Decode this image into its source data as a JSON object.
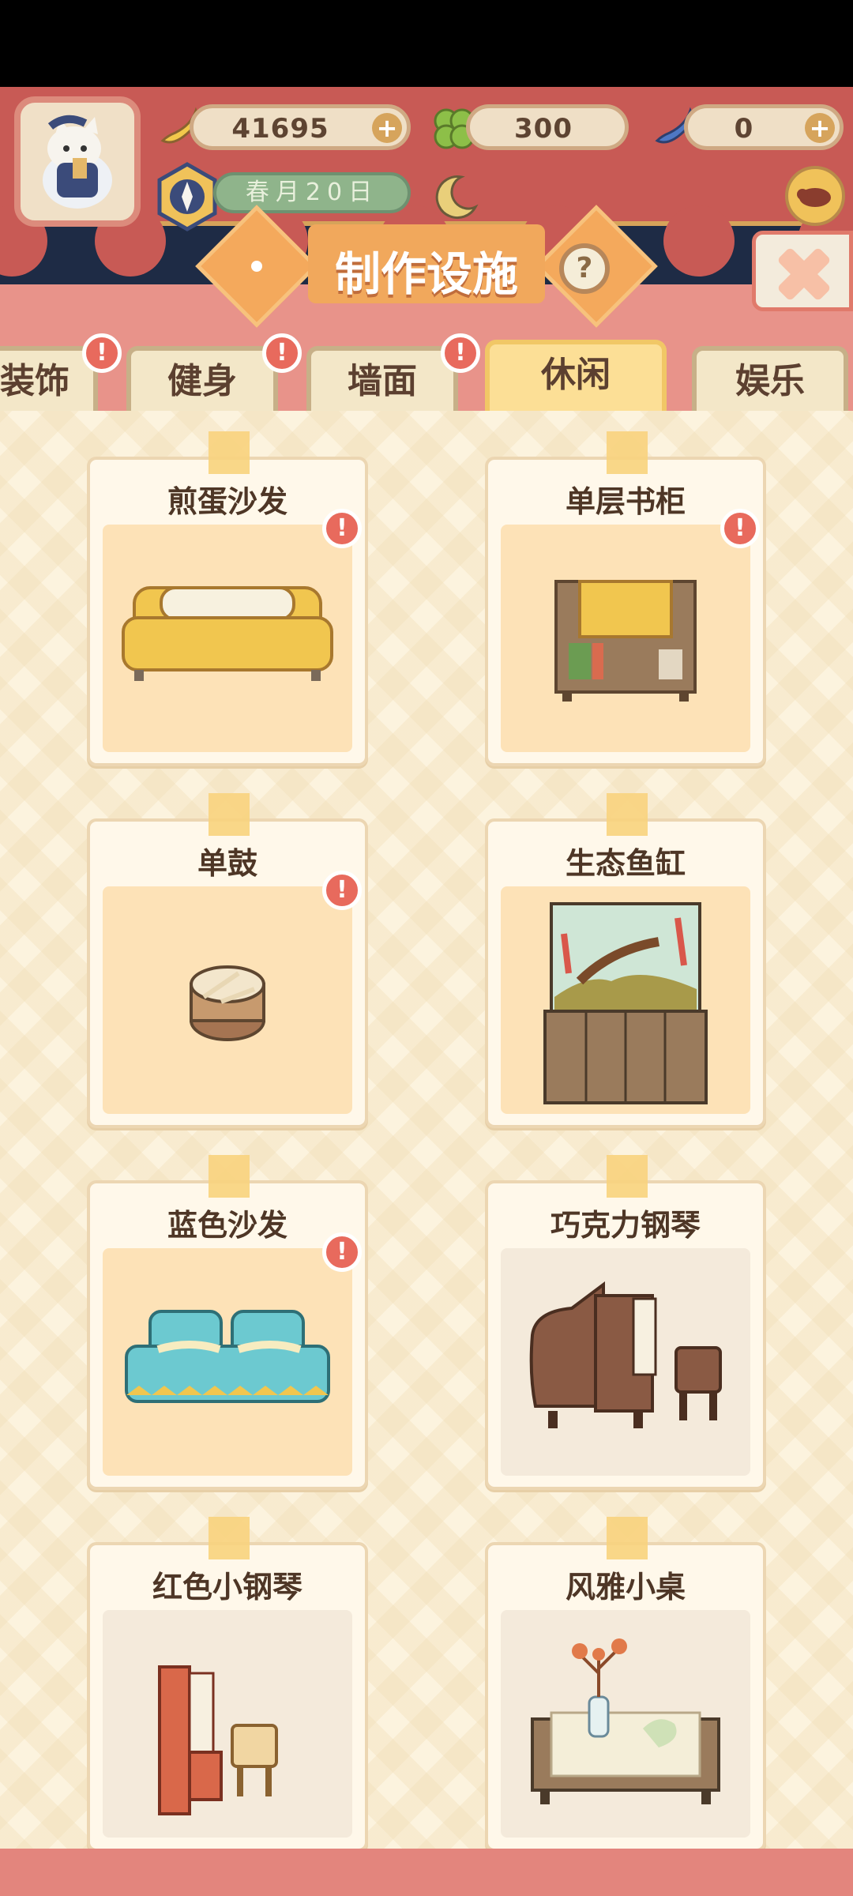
{
  "header": {
    "currency": [
      {
        "icon": "banana-icon",
        "value": "41695",
        "plus": "+"
      },
      {
        "icon": "clover-icon",
        "value": "300",
        "plus": ""
      },
      {
        "icon": "blue-banana-icon",
        "value": "0",
        "plus": "+"
      }
    ],
    "date": "春月20日"
  },
  "title": "制作设施",
  "help_label": "?",
  "tabs": [
    {
      "label": "装饰",
      "badge": "!"
    },
    {
      "label": "健身",
      "badge": "!"
    },
    {
      "label": "墙面",
      "badge": "!"
    },
    {
      "label": "休闲",
      "badge": ""
    },
    {
      "label": "娱乐",
      "badge": ""
    }
  ],
  "active_tab": "休闲",
  "items": [
    {
      "name": "煎蛋沙发",
      "badge": "!",
      "icon": "egg-sofa-icon"
    },
    {
      "name": "单层书柜",
      "badge": "!",
      "icon": "bookshelf-icon"
    },
    {
      "name": "单鼓",
      "badge": "!",
      "icon": "drum-icon"
    },
    {
      "name": "生态鱼缸",
      "badge": "",
      "icon": "aquarium-icon"
    },
    {
      "name": "蓝色沙发",
      "badge": "!",
      "icon": "blue-sofa-icon"
    },
    {
      "name": "巧克力钢琴",
      "badge": "",
      "icon": "grand-piano-icon"
    },
    {
      "name": "红色小钢琴",
      "badge": "",
      "icon": "red-piano-icon"
    },
    {
      "name": "风雅小桌",
      "badge": "",
      "icon": "elegant-table-icon"
    }
  ],
  "colors": {
    "accent": "#f1a85c",
    "badge": "#e86a5d",
    "header": "#c85a55"
  }
}
